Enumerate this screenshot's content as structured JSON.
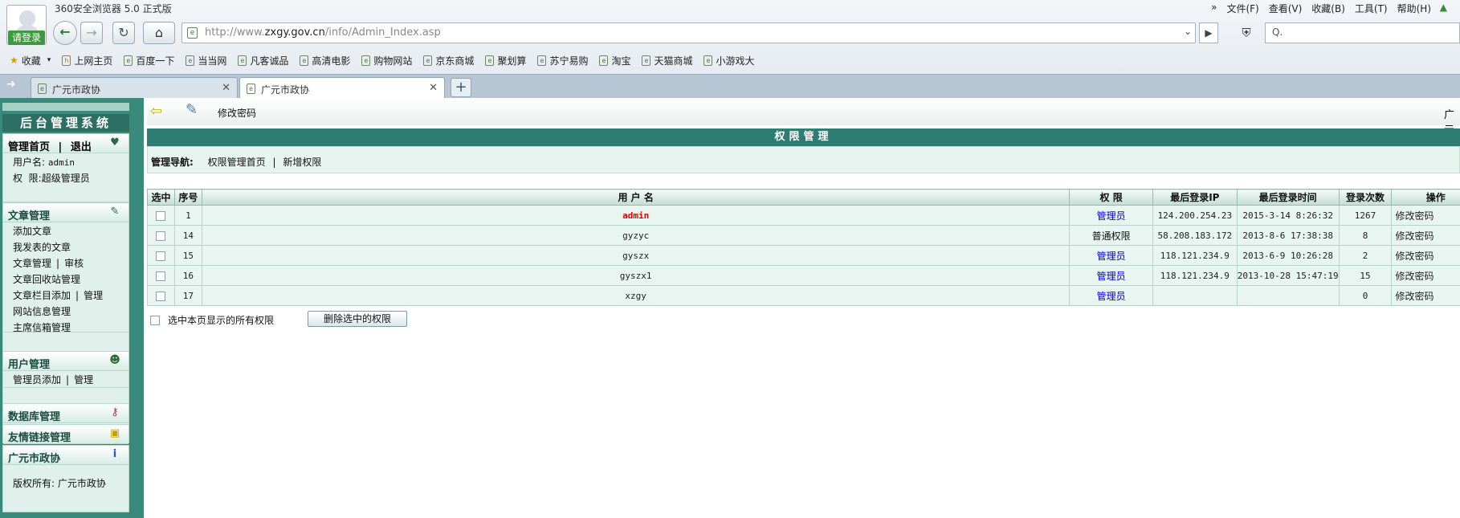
{
  "browser": {
    "title": "360安全浏览器 5.0 正式版",
    "login": "请登录",
    "url_prefix": "http://www.",
    "url_domain": "zxgy.gov.cn",
    "url_path": "/info/Admin_Index.asp",
    "menu": [
      "文件(F)",
      "查看(V)",
      "收藏(B)",
      "工具(T)",
      "帮助(H)"
    ],
    "menu_more": "»",
    "search_icon": "Q.",
    "bookmarks": [
      "收藏",
      "上网主页",
      "百度一下",
      "当当网",
      "凡客诚品",
      "高清电影",
      "购物网站",
      "京东商城",
      "聚划算",
      "苏宁易购",
      "淘宝",
      "天猫商城",
      "小游戏大"
    ],
    "tabs": [
      {
        "label": "广元市政协"
      },
      {
        "label": "广元市政协"
      }
    ],
    "icons": {
      "back": "arrow-left-icon",
      "forward": "arrow-right-icon",
      "refresh": "refresh-icon",
      "home": "home-icon",
      "shield": "shield-icon"
    }
  },
  "sidebar": {
    "title": "后台管理系统",
    "home": {
      "link": "管理首页",
      "sep": "|",
      "logout": "退出",
      "username_label": "用户名:",
      "username": "admin",
      "role_label": "权  限:",
      "role": "超级管理员"
    },
    "article": {
      "head": "文章管理",
      "items": [
        "添加文章",
        "我发表的文章",
        "文章管理",
        "审核",
        "文章回收站管理",
        "文章栏目添加",
        "管理",
        "网站信息管理",
        "主席信箱管理"
      ],
      "sep": "|"
    },
    "user": {
      "head": "用户管理",
      "items": [
        "管理员添加",
        "管理"
      ],
      "sep": "|"
    },
    "db": {
      "head": "数据库管理"
    },
    "links": {
      "head": "友情链接管理"
    },
    "org": {
      "head": "广元市政协",
      "copyright": "版权所有: 广元市政协"
    }
  },
  "toolbar": {
    "label": "修改密码",
    "right": "广元"
  },
  "permissions": {
    "title": "权限管理",
    "nav_label": "管理导航:",
    "nav_home": "权限管理首页",
    "nav_sep": "|",
    "nav_add": "新增权限",
    "columns": [
      "选中",
      "序号",
      "用 户 名",
      "权 限",
      "最后登录IP",
      "最后登录时间",
      "登录次数",
      "操作"
    ],
    "rows": [
      {
        "id": "1",
        "user": "admin",
        "role": "管理员",
        "ip": "124.200.254.23",
        "time": "2015-3-14 8:26:32",
        "count": "1267",
        "action": "修改密码"
      },
      {
        "id": "14",
        "user": "gyzyc",
        "role": "普通权限",
        "ip": "58.208.183.172",
        "time": "2013-8-6 17:38:38",
        "count": "8",
        "action": "修改密码"
      },
      {
        "id": "15",
        "user": "gyszx",
        "role": "管理员",
        "ip": "118.121.234.9",
        "time": "2013-6-9 10:26:28",
        "count": "2",
        "action": "修改密码"
      },
      {
        "id": "16",
        "user": "gyszx1",
        "role": "管理员",
        "ip": "118.121.234.9",
        "time": "2013-10-28 15:47:19",
        "count": "15",
        "action": "修改密码"
      },
      {
        "id": "17",
        "user": "xzgy",
        "role": "管理员",
        "ip": "",
        "time": "",
        "count": "0",
        "action": "修改密码"
      }
    ],
    "select_all": "选中本页显示的所有权限",
    "delete_btn": "删除选中的权限"
  }
}
